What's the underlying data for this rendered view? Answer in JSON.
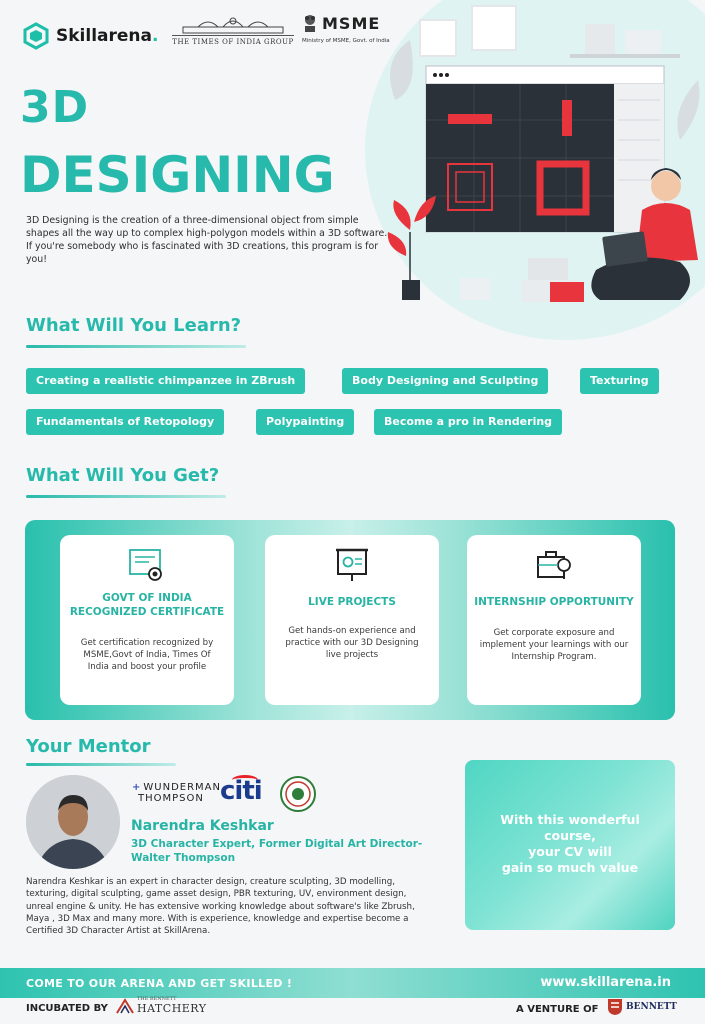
{
  "header": {
    "brand": "Skillarena",
    "brand_dot": ".",
    "partner_1_caption": "THE TIMES OF INDIA GROUP",
    "partner_2_title": "MSME",
    "partner_2_caption": "Ministry of MSME, Govt. of India"
  },
  "hero": {
    "title_line_1": "3D",
    "title_line_2": "DESIGNING",
    "intro": "3D Designing is the creation of a three-dimensional object from simple shapes all the way up to complex high-polygon models within a 3D software. If you're somebody who is fascinated with 3D creations, this program is for you!"
  },
  "learn": {
    "title": "What Will You Learn?",
    "topics": [
      "Creating a realistic chimpanzee in ZBrush",
      "Body Designing and Sculpting",
      "Texturing",
      "Fundamentals of Retopology",
      "Polypainting",
      "Become a pro in Rendering"
    ]
  },
  "get": {
    "title": "What Will You Get?",
    "cards": [
      {
        "icon": "certificate-icon",
        "title": "GOVT OF INDIA RECOGNIZED CERTIFICATE",
        "desc": "Get certification recognized by MSME,Govt of India, Times Of India and boost your profile"
      },
      {
        "icon": "presentation-icon",
        "title": "LIVE PROJECTS",
        "desc": "Get hands-on experience and practice with our 3D Designing live projects"
      },
      {
        "icon": "briefcase-icon",
        "title": "INTERNSHIP OPPORTUNITY",
        "desc": "Get corporate exposure and implement your learnings with our Internship Program."
      }
    ]
  },
  "mentor": {
    "title": "Your Mentor",
    "company_1_line_1": "WUNDERMAN",
    "company_1_line_2": "THOMPSON",
    "company_2": "citi",
    "name": "Narendra Keshkar",
    "role": "3D Character Expert, Former Digital Art Director- Walter Thompson",
    "bio": "Narendra Keshkar is an expert in character design, creature sculpting, 3D modelling, texturing, digital sculpting, game asset design, PBR texturing, UV, environment design, unreal engine & unity. He has extensive working knowledge about software's like Zbrush, Maya , 3D Max and many more. With is experience, knowledge and expertise become a Certified 3D Character Artist at SkillArena."
  },
  "cv_box": {
    "line_1": "With this wonderful",
    "line_2": "course,",
    "line_3": "your CV will",
    "line_4": "gain so much value"
  },
  "footer": {
    "tagline": "COME TO OUR ARENA AND GET SKILLED !",
    "url": "www.skillarena.in",
    "incubated_label": "INCUBATED BY",
    "incubator_small": "THE BENNETT",
    "incubator_big": "HATCHERY",
    "venture_label": "A VENTURE OF",
    "university": "BENNETT"
  },
  "colors": {
    "accent": "#27b9ab",
    "chip": "#2cc3b0",
    "illustration_red": "#e8353d",
    "illustration_dark": "#2b3138"
  }
}
